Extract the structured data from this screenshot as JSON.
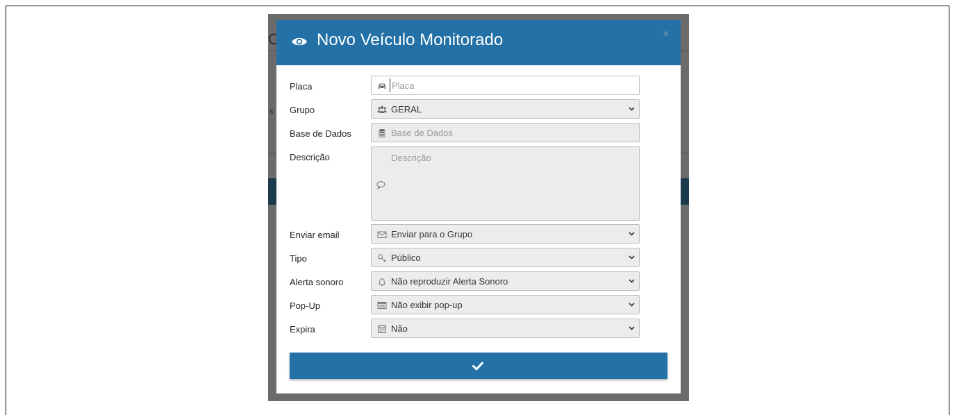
{
  "modal": {
    "title": "Novo Veículo Monitorado",
    "close_label": "×",
    "submit_icon": "check-icon"
  },
  "background": {
    "partial_letter": "C",
    "partial_s": "s"
  },
  "form": {
    "placa": {
      "label": "Placa",
      "placeholder": "Placa",
      "value": "",
      "icon": "car-icon"
    },
    "grupo": {
      "label": "Grupo",
      "value": "GERAL",
      "icon": "users-icon"
    },
    "base_dados": {
      "label": "Base de Dados",
      "placeholder": "Base de Dados",
      "icon": "database-icon"
    },
    "descricao": {
      "label": "Descrição",
      "placeholder": "Descrição",
      "icon": "comment-icon"
    },
    "enviar_email": {
      "label": "Enviar email",
      "value": "Enviar para o Grupo",
      "icon": "envelope-icon"
    },
    "tipo": {
      "label": "Tipo",
      "value": "Público",
      "icon": "key-icon"
    },
    "alerta_sonoro": {
      "label": "Alerta sonoro",
      "value": "Não reproduzir Alerta Sonoro",
      "icon": "bell-icon"
    },
    "popup": {
      "label": "Pop-Up",
      "value": "Não exibir pop-up",
      "icon": "window-icon"
    },
    "expira": {
      "label": "Expira",
      "value": "Não",
      "icon": "calendar-icon"
    }
  },
  "colors": {
    "header": "#2371a6",
    "button": "#2371a6",
    "backdrop": "#6b6b6b",
    "field_bg": "#ececec"
  }
}
